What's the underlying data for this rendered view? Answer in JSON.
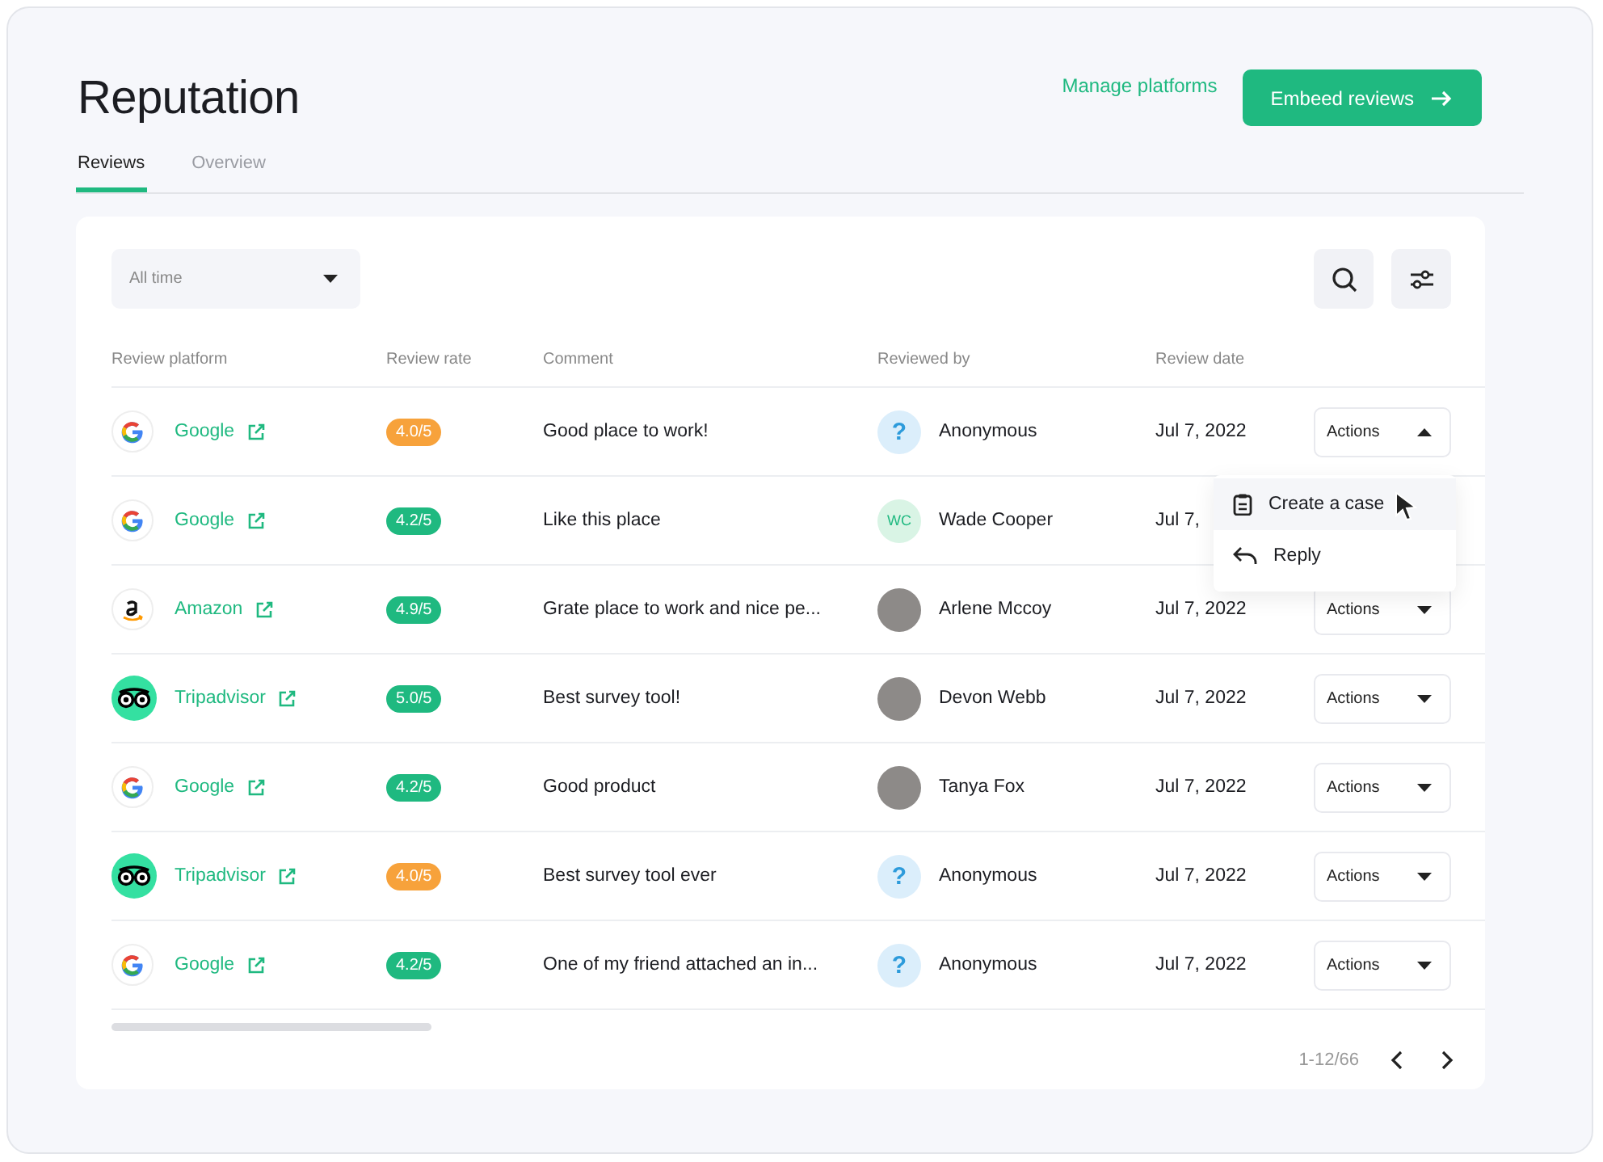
{
  "header": {
    "title": "Reputation",
    "manage_link": "Manage platforms",
    "embed_button": "Embeed reviews"
  },
  "tabs": [
    {
      "label": "Reviews",
      "selected": true
    },
    {
      "label": "Overview",
      "selected": false
    }
  ],
  "filter": {
    "value": "All time"
  },
  "table": {
    "columns": [
      "Review platform",
      "Review rate",
      "Comment",
      "Reviewed by",
      "Review date"
    ],
    "rows": [
      {
        "platform": {
          "kind": "google",
          "name": "Google"
        },
        "rate": {
          "text": "4.0/5",
          "color": "#f7a23b"
        },
        "comment": "Good place to work!",
        "reviewer": {
          "kind": "anonymous",
          "mark": "?",
          "name": "Anonymous"
        },
        "date": "Jul 7, 2022",
        "actions": {
          "label": "Actions",
          "expanded": true,
          "menu": [
            {
              "kind": "case",
              "label": "Create a case",
              "selected": true
            },
            {
              "kind": "reply",
              "label": "Reply",
              "selected": false
            }
          ]
        }
      },
      {
        "platform": {
          "kind": "google",
          "name": "Google"
        },
        "rate": {
          "text": "4.2/5",
          "color": "#1fb980"
        },
        "comment": "Like this place",
        "reviewer": {
          "kind": "initials",
          "mark": "WC",
          "name": "Wade Cooper"
        },
        "date": "Jul 7,"
      },
      {
        "platform": {
          "kind": "amazon",
          "name": "Amazon"
        },
        "rate": {
          "text": "4.9/5",
          "color": "#1fb980"
        },
        "comment": "Grate place to work and nice pe...",
        "reviewer": {
          "kind": "photo",
          "name": "Arlene Mccoy"
        },
        "date": "Jul 7, 2022",
        "actions": {
          "label": "Actions",
          "expanded": false
        }
      },
      {
        "platform": {
          "kind": "tripadvisor",
          "name": "Tripadvisor"
        },
        "rate": {
          "text": "5.0/5",
          "color": "#1fb980"
        },
        "comment": "Best survey tool!",
        "reviewer": {
          "kind": "photo",
          "name": "Devon Webb"
        },
        "date": "Jul 7, 2022",
        "actions": {
          "label": "Actions",
          "expanded": false
        }
      },
      {
        "platform": {
          "kind": "google",
          "name": "Google"
        },
        "rate": {
          "text": "4.2/5",
          "color": "#1fb980"
        },
        "comment": "Good product",
        "reviewer": {
          "kind": "photo",
          "name": "Tanya Fox"
        },
        "date": "Jul 7, 2022",
        "actions": {
          "label": "Actions",
          "expanded": false
        }
      },
      {
        "platform": {
          "kind": "tripadvisor",
          "name": "Tripadvisor"
        },
        "rate": {
          "text": "4.0/5",
          "color": "#f7a23b"
        },
        "comment": "Best survey tool ever",
        "reviewer": {
          "kind": "anonymous",
          "mark": "?",
          "name": "Anonymous"
        },
        "date": "Jul 7, 2022",
        "actions": {
          "label": "Actions",
          "expanded": false
        }
      },
      {
        "platform": {
          "kind": "google",
          "name": "Google"
        },
        "rate": {
          "text": "4.2/5",
          "color": "#1fb980"
        },
        "comment": "One of my friend attached an in...",
        "reviewer": {
          "kind": "anonymous",
          "mark": "?",
          "name": "Anonymous"
        },
        "date": "Jul 7, 2022",
        "actions": {
          "label": "Actions",
          "expanded": false
        }
      }
    ]
  },
  "pagination": {
    "range": "1-12/66"
  }
}
